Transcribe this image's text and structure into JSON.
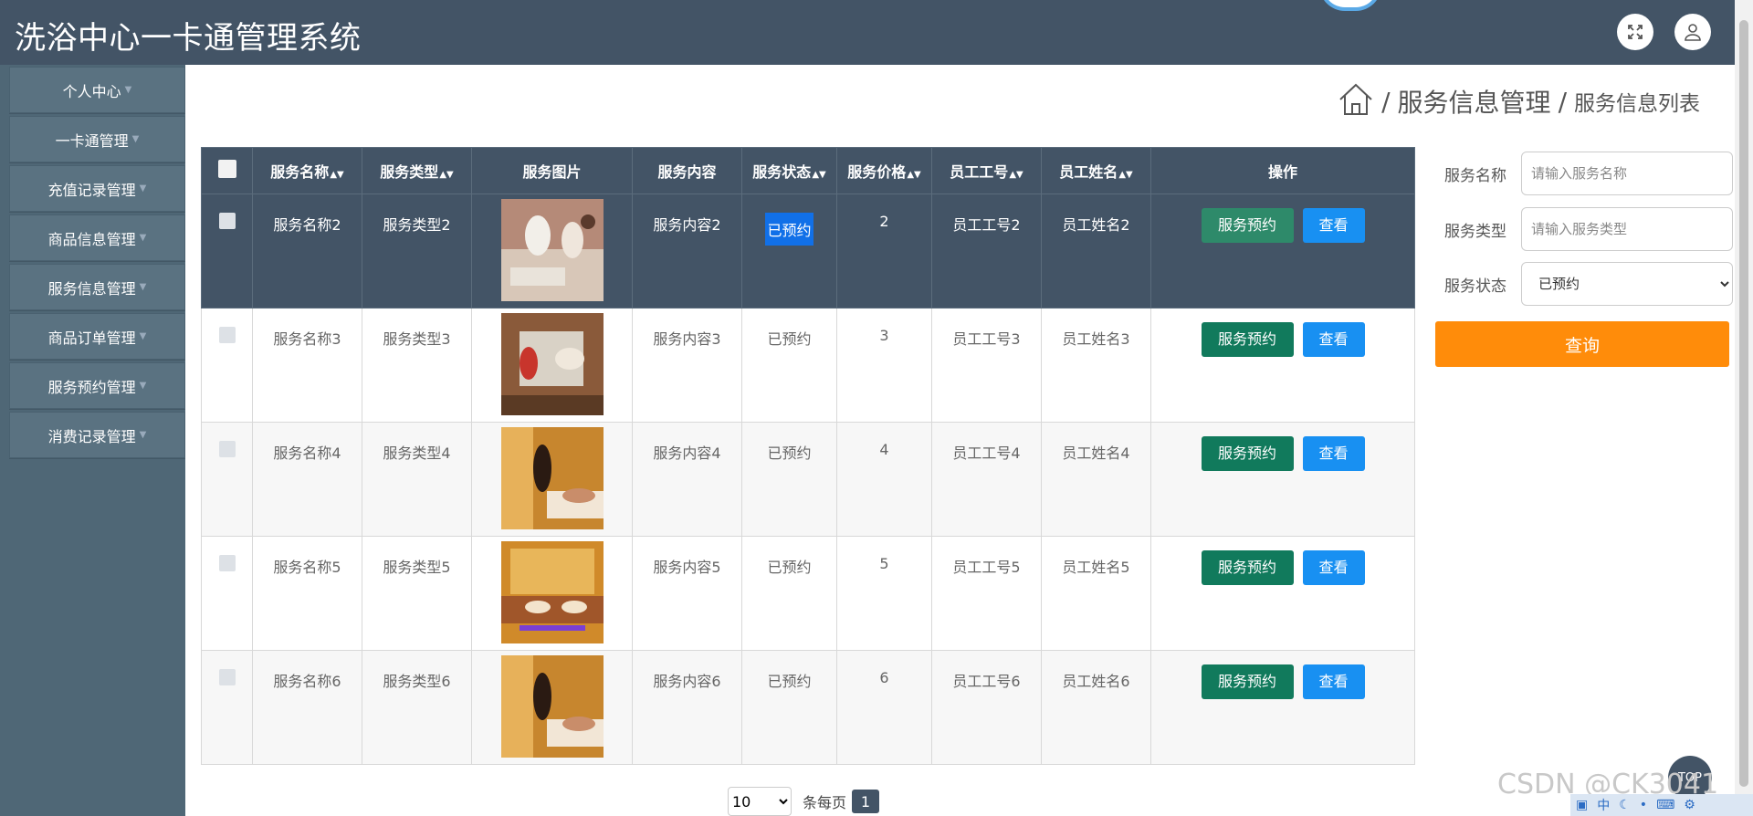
{
  "header": {
    "title": "洗浴中心一卡通管理系统",
    "icons": [
      "fullscreen-icon",
      "user-icon"
    ]
  },
  "sidebar": {
    "items": [
      {
        "label": "个人中心"
      },
      {
        "label": "一卡通管理"
      },
      {
        "label": "充值记录管理"
      },
      {
        "label": "商品信息管理"
      },
      {
        "label": "服务信息管理"
      },
      {
        "label": "商品订单管理"
      },
      {
        "label": "服务预约管理"
      },
      {
        "label": "消费记录管理"
      }
    ]
  },
  "breadcrumb": {
    "sep": "/",
    "section": "服务信息管理",
    "page": "服务信息列表"
  },
  "table": {
    "columns": [
      "服务名称",
      "服务类型",
      "服务图片",
      "服务内容",
      "服务状态",
      "服务价格",
      "员工工号",
      "员工姓名",
      "操作"
    ],
    "book_label": "服务预约",
    "view_label": "查看",
    "rows": [
      {
        "name": "服务名称2",
        "type": "服务类型2",
        "content": "服务内容2",
        "status": "已预约",
        "price": "2",
        "emp_no": "员工工号2",
        "emp_name": "员工姓名2"
      },
      {
        "name": "服务名称3",
        "type": "服务类型3",
        "content": "服务内容3",
        "status": "已预约",
        "price": "3",
        "emp_no": "员工工号3",
        "emp_name": "员工姓名3"
      },
      {
        "name": "服务名称4",
        "type": "服务类型4",
        "content": "服务内容4",
        "status": "已预约",
        "price": "4",
        "emp_no": "员工工号4",
        "emp_name": "员工姓名4"
      },
      {
        "name": "服务名称5",
        "type": "服务类型5",
        "content": "服务内容5",
        "status": "已预约",
        "price": "5",
        "emp_no": "员工工号5",
        "emp_name": "员工姓名5"
      },
      {
        "name": "服务名称6",
        "type": "服务类型6",
        "content": "服务内容6",
        "status": "已预约",
        "price": "6",
        "emp_no": "员工工号6",
        "emp_name": "员工姓名6"
      }
    ]
  },
  "filter": {
    "name_label": "服务名称",
    "name_placeholder": "请输入服务名称",
    "type_label": "服务类型",
    "type_placeholder": "请输入服务类型",
    "status_label": "服务状态",
    "status_value": "已预约",
    "query_label": "查询"
  },
  "pager": {
    "page_size": "10",
    "per_page_label": "条每页",
    "current_page": "1"
  },
  "back_top": "TOP",
  "watermark": "CSDN @CK3041",
  "colors": {
    "header_bg": "#435466",
    "sidebar_bg": "#4f6776",
    "book_button": "#117a5c",
    "view_button": "#1890f2",
    "query_button": "#ff8c0a"
  }
}
